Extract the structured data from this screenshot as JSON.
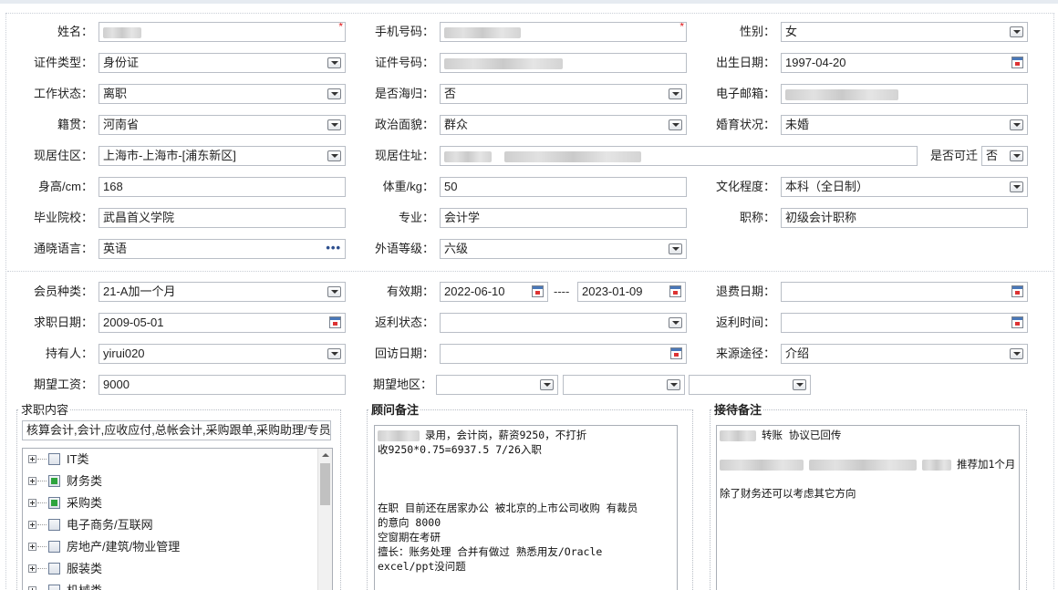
{
  "required_mark": "*",
  "personal": {
    "name": {
      "label": "姓名："
    },
    "phone": {
      "label": "手机号码："
    },
    "gender": {
      "label": "性别：",
      "value": "女"
    },
    "id_type": {
      "label": "证件类型：",
      "value": "身份证"
    },
    "id_number": {
      "label": "证件号码："
    },
    "birth_date": {
      "label": "出生日期：",
      "value": "1997-04-20"
    },
    "work_status": {
      "label": "工作状态：",
      "value": "离职"
    },
    "returnee": {
      "label": "是否海归：",
      "value": "否"
    },
    "email": {
      "label": "电子邮箱："
    },
    "native_place": {
      "label": "籍贯：",
      "value": "河南省"
    },
    "political": {
      "label": "政治面貌：",
      "value": "群众"
    },
    "marital": {
      "label": "婚育状况：",
      "value": "未婚"
    },
    "residence_area": {
      "label": "现居住区：",
      "value": "上海市-上海市-[浦东新区]"
    },
    "address": {
      "label": "现居住址："
    },
    "relocate": {
      "label": "是否可迁",
      "value": "否"
    },
    "height": {
      "label": "身高/cm：",
      "value": "168"
    },
    "weight": {
      "label": "体重/kg：",
      "value": "50"
    },
    "education": {
      "label": "文化程度：",
      "value": "本科（全日制）"
    },
    "school": {
      "label": "毕业院校：",
      "value": "武昌首义学院"
    },
    "major": {
      "label": "专业：",
      "value": "会计学"
    },
    "title": {
      "label": "职称：",
      "value": "初级会计职称"
    },
    "languages": {
      "label": "通晓语言：",
      "value": "英语"
    },
    "language_level": {
      "label": "外语等级：",
      "value": "六级"
    }
  },
  "membership": {
    "member_type": {
      "label": "会员种类：",
      "value": "21-A加一个月"
    },
    "valid_period": {
      "label": "有效期：",
      "start": "2022-06-10",
      "separator": "----",
      "end": "2023-01-09"
    },
    "refund_date": {
      "label": "退费日期：",
      "value": ""
    },
    "job_date": {
      "label": "求职日期：",
      "value": "2009-05-01"
    },
    "rebate_status": {
      "label": "返利状态：",
      "value": ""
    },
    "rebate_time": {
      "label": "返利时间：",
      "value": ""
    },
    "holder": {
      "label": "持有人：",
      "value": "yirui020"
    },
    "visit_date": {
      "label": "回访日期：",
      "value": ""
    },
    "source": {
      "label": "来源途径：",
      "value": "介绍"
    },
    "salary": {
      "label": "期望工资：",
      "value": "9000"
    },
    "region": {
      "label": "期望地区："
    }
  },
  "job_content": {
    "title": "求职内容",
    "summary": "核算会计,会计,应收应付,总帐会计,采购跟单,采购助理/专员",
    "tree": [
      {
        "label": "IT类",
        "state": "unchecked"
      },
      {
        "label": "财务类",
        "state": "partial"
      },
      {
        "label": "采购类",
        "state": "partial"
      },
      {
        "label": "电子商务/互联网",
        "state": "unchecked"
      },
      {
        "label": "房地产/建筑/物业管理",
        "state": "unchecked"
      },
      {
        "label": "服装类",
        "state": "unchecked"
      },
      {
        "label": "机械类",
        "state": "unchecked"
      }
    ]
  },
  "consultant_notes": {
    "title": "顾问备注",
    "lines": [
      "录用，会计岗，薪资9250，不打折",
      "收9250*0.75=6937.5  7/26入职",
      "",
      "",
      "",
      "在职 目前还在居家办公 被北京的上市公司收购 有裁员",
      "的意向  8000",
      "空窗期在考研",
      "擅长：账务处理 合并有做过 熟悉用友/Oracle",
      "excel/ppt没问题"
    ]
  },
  "reception_notes": {
    "title": "接待备注",
    "lines": [
      "转账   协议已回传",
      "",
      "推荐加1个月",
      "",
      "除了财务还可以考虑其它方向"
    ]
  }
}
